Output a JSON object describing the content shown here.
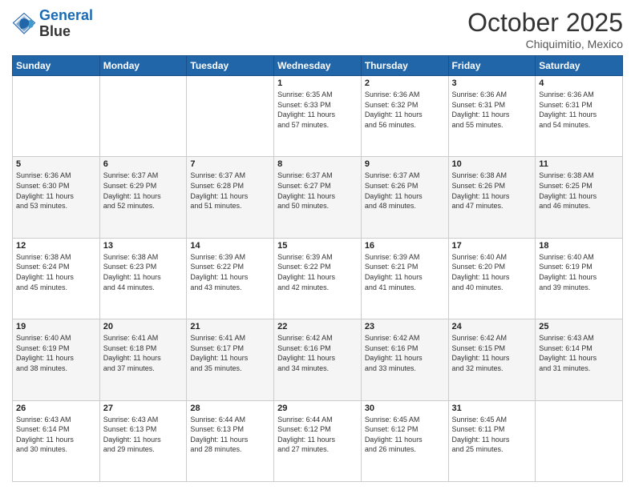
{
  "header": {
    "logo_line1": "General",
    "logo_line2": "Blue",
    "month": "October 2025",
    "location": "Chiquimitio, Mexico"
  },
  "weekdays": [
    "Sunday",
    "Monday",
    "Tuesday",
    "Wednesday",
    "Thursday",
    "Friday",
    "Saturday"
  ],
  "weeks": [
    [
      {
        "day": "",
        "info": ""
      },
      {
        "day": "",
        "info": ""
      },
      {
        "day": "",
        "info": ""
      },
      {
        "day": "1",
        "info": "Sunrise: 6:35 AM\nSunset: 6:33 PM\nDaylight: 11 hours\nand 57 minutes."
      },
      {
        "day": "2",
        "info": "Sunrise: 6:36 AM\nSunset: 6:32 PM\nDaylight: 11 hours\nand 56 minutes."
      },
      {
        "day": "3",
        "info": "Sunrise: 6:36 AM\nSunset: 6:31 PM\nDaylight: 11 hours\nand 55 minutes."
      },
      {
        "day": "4",
        "info": "Sunrise: 6:36 AM\nSunset: 6:31 PM\nDaylight: 11 hours\nand 54 minutes."
      }
    ],
    [
      {
        "day": "5",
        "info": "Sunrise: 6:36 AM\nSunset: 6:30 PM\nDaylight: 11 hours\nand 53 minutes."
      },
      {
        "day": "6",
        "info": "Sunrise: 6:37 AM\nSunset: 6:29 PM\nDaylight: 11 hours\nand 52 minutes."
      },
      {
        "day": "7",
        "info": "Sunrise: 6:37 AM\nSunset: 6:28 PM\nDaylight: 11 hours\nand 51 minutes."
      },
      {
        "day": "8",
        "info": "Sunrise: 6:37 AM\nSunset: 6:27 PM\nDaylight: 11 hours\nand 50 minutes."
      },
      {
        "day": "9",
        "info": "Sunrise: 6:37 AM\nSunset: 6:26 PM\nDaylight: 11 hours\nand 48 minutes."
      },
      {
        "day": "10",
        "info": "Sunrise: 6:38 AM\nSunset: 6:26 PM\nDaylight: 11 hours\nand 47 minutes."
      },
      {
        "day": "11",
        "info": "Sunrise: 6:38 AM\nSunset: 6:25 PM\nDaylight: 11 hours\nand 46 minutes."
      }
    ],
    [
      {
        "day": "12",
        "info": "Sunrise: 6:38 AM\nSunset: 6:24 PM\nDaylight: 11 hours\nand 45 minutes."
      },
      {
        "day": "13",
        "info": "Sunrise: 6:38 AM\nSunset: 6:23 PM\nDaylight: 11 hours\nand 44 minutes."
      },
      {
        "day": "14",
        "info": "Sunrise: 6:39 AM\nSunset: 6:22 PM\nDaylight: 11 hours\nand 43 minutes."
      },
      {
        "day": "15",
        "info": "Sunrise: 6:39 AM\nSunset: 6:22 PM\nDaylight: 11 hours\nand 42 minutes."
      },
      {
        "day": "16",
        "info": "Sunrise: 6:39 AM\nSunset: 6:21 PM\nDaylight: 11 hours\nand 41 minutes."
      },
      {
        "day": "17",
        "info": "Sunrise: 6:40 AM\nSunset: 6:20 PM\nDaylight: 11 hours\nand 40 minutes."
      },
      {
        "day": "18",
        "info": "Sunrise: 6:40 AM\nSunset: 6:19 PM\nDaylight: 11 hours\nand 39 minutes."
      }
    ],
    [
      {
        "day": "19",
        "info": "Sunrise: 6:40 AM\nSunset: 6:19 PM\nDaylight: 11 hours\nand 38 minutes."
      },
      {
        "day": "20",
        "info": "Sunrise: 6:41 AM\nSunset: 6:18 PM\nDaylight: 11 hours\nand 37 minutes."
      },
      {
        "day": "21",
        "info": "Sunrise: 6:41 AM\nSunset: 6:17 PM\nDaylight: 11 hours\nand 35 minutes."
      },
      {
        "day": "22",
        "info": "Sunrise: 6:42 AM\nSunset: 6:16 PM\nDaylight: 11 hours\nand 34 minutes."
      },
      {
        "day": "23",
        "info": "Sunrise: 6:42 AM\nSunset: 6:16 PM\nDaylight: 11 hours\nand 33 minutes."
      },
      {
        "day": "24",
        "info": "Sunrise: 6:42 AM\nSunset: 6:15 PM\nDaylight: 11 hours\nand 32 minutes."
      },
      {
        "day": "25",
        "info": "Sunrise: 6:43 AM\nSunset: 6:14 PM\nDaylight: 11 hours\nand 31 minutes."
      }
    ],
    [
      {
        "day": "26",
        "info": "Sunrise: 6:43 AM\nSunset: 6:14 PM\nDaylight: 11 hours\nand 30 minutes."
      },
      {
        "day": "27",
        "info": "Sunrise: 6:43 AM\nSunset: 6:13 PM\nDaylight: 11 hours\nand 29 minutes."
      },
      {
        "day": "28",
        "info": "Sunrise: 6:44 AM\nSunset: 6:13 PM\nDaylight: 11 hours\nand 28 minutes."
      },
      {
        "day": "29",
        "info": "Sunrise: 6:44 AM\nSunset: 6:12 PM\nDaylight: 11 hours\nand 27 minutes."
      },
      {
        "day": "30",
        "info": "Sunrise: 6:45 AM\nSunset: 6:12 PM\nDaylight: 11 hours\nand 26 minutes."
      },
      {
        "day": "31",
        "info": "Sunrise: 6:45 AM\nSunset: 6:11 PM\nDaylight: 11 hours\nand 25 minutes."
      },
      {
        "day": "",
        "info": ""
      }
    ]
  ]
}
